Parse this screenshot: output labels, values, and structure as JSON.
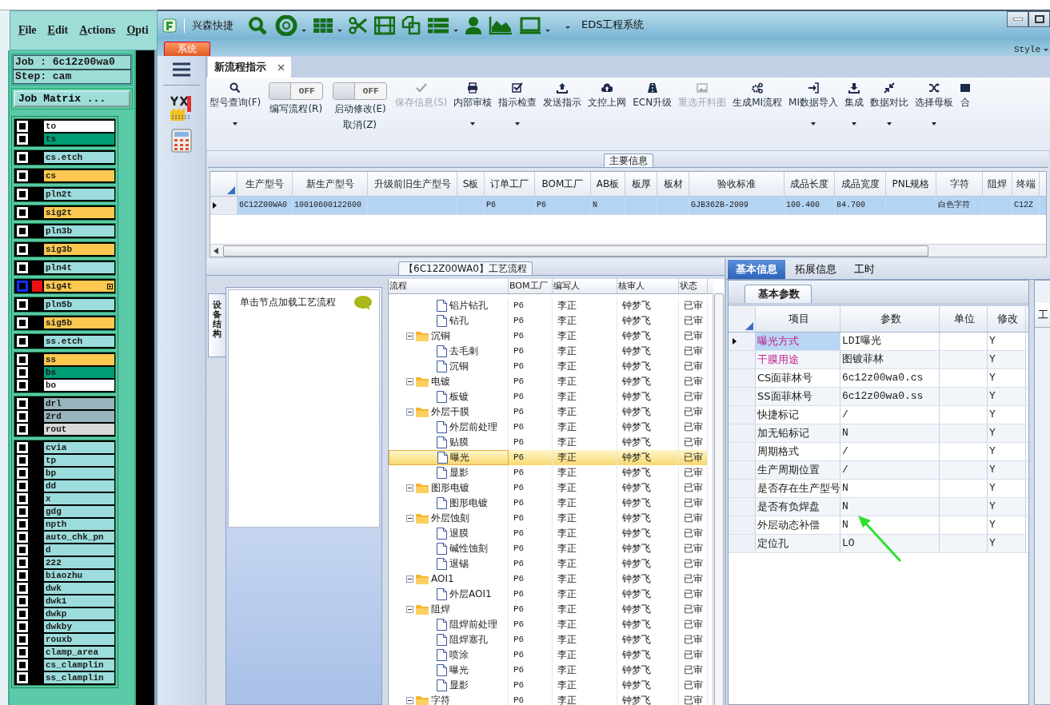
{
  "genesis": {
    "menu": [
      "File",
      "Edit",
      "Actions",
      "Opti"
    ],
    "job": "Job : 6c12z00wa0",
    "step": "Step: cam",
    "matrix_button": "Job Matrix ...",
    "layer_groups": [
      {
        "layers": [
          {
            "name": "to",
            "color": "#ffffff",
            "selected": false
          },
          {
            "name": "ts",
            "color": "#009c74",
            "selected": false
          }
        ]
      },
      {
        "layers": [
          {
            "name": "cs.etch",
            "color": "#9cdcdc",
            "selected": false
          }
        ]
      },
      {
        "layers": [
          {
            "name": "cs",
            "color": "#fcc850",
            "selected": false
          }
        ]
      },
      {
        "layers": [
          {
            "name": "pln2t",
            "color": "#9cdcdc",
            "selected": false
          }
        ]
      },
      {
        "layers": [
          {
            "name": "sig2t",
            "color": "#fcc850",
            "selected": false
          }
        ]
      },
      {
        "layers": [
          {
            "name": "pln3b",
            "color": "#9cdcdc",
            "selected": false
          }
        ]
      },
      {
        "layers": [
          {
            "name": "sig3b",
            "color": "#fcc850",
            "selected": false
          }
        ]
      },
      {
        "layers": [
          {
            "name": "pln4t",
            "color": "#9cdcdc",
            "selected": false
          }
        ]
      },
      {
        "layers": [
          {
            "name": "sig4t",
            "color": "#fcc850",
            "selected": true
          }
        ]
      },
      {
        "layers": [
          {
            "name": "pln5b",
            "color": "#9cdcdc",
            "selected": false
          }
        ]
      },
      {
        "layers": [
          {
            "name": "sig5b",
            "color": "#fcc850",
            "selected": false
          }
        ]
      },
      {
        "layers": [
          {
            "name": "ss.etch",
            "color": "#9cdcdc",
            "selected": false
          }
        ]
      },
      {
        "layers": [
          {
            "name": "ss",
            "color": "#fcc850",
            "selected": false
          },
          {
            "name": "bs",
            "color": "#009c74",
            "selected": false
          },
          {
            "name": "bo",
            "color": "#ffffff",
            "selected": false
          }
        ]
      },
      {
        "layers": [
          {
            "name": "drl",
            "color": "#98b4bc",
            "selected": false
          },
          {
            "name": "2rd",
            "color": "#98b4bc",
            "selected": false
          },
          {
            "name": "rout",
            "color": "#d8d8d8",
            "selected": false
          }
        ]
      },
      {
        "layers": [
          {
            "name": "cvia",
            "color": "#9cdcdc",
            "selected": false
          },
          {
            "name": "tp",
            "color": "#9cdcdc",
            "selected": false
          },
          {
            "name": "bp",
            "color": "#9cdcdc",
            "selected": false
          },
          {
            "name": "dd",
            "color": "#9cdcdc",
            "selected": false
          },
          {
            "name": "x",
            "color": "#9cdcdc",
            "selected": false
          },
          {
            "name": "gdg",
            "color": "#9cdcdc",
            "selected": false
          },
          {
            "name": "npth",
            "color": "#9cdcdc",
            "selected": false
          },
          {
            "name": "auto_chk_pn",
            "color": "#9cdcdc",
            "selected": false
          },
          {
            "name": "d",
            "color": "#9cdcdc",
            "selected": false
          },
          {
            "name": "222",
            "color": "#9cdcdc",
            "selected": false
          },
          {
            "name": "biaozhu",
            "color": "#9cdcdc",
            "selected": false
          },
          {
            "name": "dwk",
            "color": "#9cdcdc",
            "selected": false
          },
          {
            "name": "dwk1",
            "color": "#9cdcdc",
            "selected": false
          },
          {
            "name": "dwkp",
            "color": "#9cdcdc",
            "selected": false
          },
          {
            "name": "dwkby",
            "color": "#9cdcdc",
            "selected": false
          },
          {
            "name": "rouxb",
            "color": "#9cdcdc",
            "selected": false
          },
          {
            "name": "clamp_area",
            "color": "#9cdcdc",
            "selected": false
          },
          {
            "name": "cs_clamplin",
            "color": "#9cdcdc",
            "selected": false
          },
          {
            "name": "ss_clamplin",
            "color": "#9cdcdc",
            "selected": false
          }
        ]
      }
    ]
  },
  "window": {
    "title": "EDS工程系统",
    "quick_access": "兴森快捷",
    "system_tab": "系统",
    "style_menu": "Style"
  },
  "tabs": [
    {
      "label": "新流程指示",
      "selected": true
    }
  ],
  "ribbon": [
    {
      "kind": "button",
      "label": "型号查询(F)",
      "dropdown": true,
      "disabled": false
    },
    {
      "kind": "toggle",
      "label": "编写流程(R)",
      "switch_text": "OFF",
      "on": false
    },
    {
      "kind": "toggle",
      "label": "启动修改(E)",
      "label2": "取消(Z)",
      "switch_text": "OFF",
      "on": false
    },
    {
      "kind": "button",
      "label": "保存信息(S)",
      "dropdown": false,
      "disabled": true
    },
    {
      "kind": "button",
      "label": "内部审核",
      "dropdown": true,
      "disabled": false
    },
    {
      "kind": "button",
      "label": "指示检查",
      "dropdown": true,
      "disabled": false
    },
    {
      "kind": "button",
      "label": "发送指示",
      "dropdown": false,
      "disabled": false
    },
    {
      "kind": "button",
      "label": "文控上网",
      "dropdown": false,
      "disabled": false
    },
    {
      "kind": "button",
      "label": "ECN升级",
      "dropdown": false,
      "disabled": false
    },
    {
      "kind": "button",
      "label": "重选开料图",
      "dropdown": false,
      "disabled": true
    },
    {
      "kind": "button",
      "label": "生成MI流程",
      "dropdown": false,
      "disabled": false
    },
    {
      "kind": "button",
      "label": "MI数据导入",
      "dropdown": true,
      "disabled": false
    },
    {
      "kind": "button",
      "label": "集成",
      "dropdown": true,
      "disabled": false
    },
    {
      "kind": "button",
      "label": "数据对比",
      "dropdown": true,
      "disabled": false
    },
    {
      "kind": "button",
      "label": "选择母板",
      "dropdown": true,
      "disabled": false
    },
    {
      "kind": "button",
      "label": "合",
      "dropdown": false,
      "disabled": false
    }
  ],
  "main_info": {
    "title": "主要信息",
    "columns": [
      {
        "label": "生产型号",
        "value": "6C12Z00WA0"
      },
      {
        "label": "新生产型号",
        "value": "10010600122600"
      },
      {
        "label": "升级前旧生产型号"
      },
      {
        "label": "S板"
      },
      {
        "label": "订单工厂",
        "value": "P6"
      },
      {
        "label": "BOM工厂",
        "value": "P6"
      },
      {
        "label": "AB板",
        "value": "N"
      },
      {
        "label": "板厚"
      },
      {
        "label": "板材"
      },
      {
        "label": "验收标准",
        "value": "GJB362B-2009"
      },
      {
        "label": "成品长度",
        "value": "100.400"
      },
      {
        "label": "成品宽度",
        "value": "84.700"
      },
      {
        "label": "PNL规格"
      },
      {
        "label": "字符",
        "value": "白色字符"
      },
      {
        "label": "阻焊"
      },
      {
        "label": "终端",
        "value": "C12Z"
      }
    ],
    "row_selected": true
  },
  "process": {
    "title": "【6C12Z00WA0】工艺流程",
    "side_tab": "设备结构",
    "hint": "单击节点加载工艺流程",
    "columns": [
      "流程",
      "BOM工厂",
      "编写人",
      "核审人",
      "状态"
    ],
    "nodes": [
      {
        "children": [
          {
            "label": "铝片钻孔",
            "bom": "P6",
            "author": "李正",
            "reviewer": "钟梦飞",
            "status": "已审",
            "selected": false
          },
          {
            "label": "钻孔",
            "bom": "P6",
            "author": "李正",
            "reviewer": "钟梦飞",
            "status": "已审",
            "selected": false
          }
        ]
      },
      {
        "label": "沉铜",
        "bom": "P6",
        "author": "李正",
        "reviewer": "钟梦飞",
        "status": "已审",
        "selected": false,
        "expanded": true,
        "children": [
          {
            "label": "去毛刺",
            "bom": "P6",
            "author": "李正",
            "reviewer": "钟梦飞",
            "status": "已审",
            "selected": false
          },
          {
            "label": "沉铜",
            "bom": "P6",
            "author": "李正",
            "reviewer": "钟梦飞",
            "status": "已审",
            "selected": false
          }
        ]
      },
      {
        "label": "电镀",
        "bom": "P6",
        "author": "李正",
        "reviewer": "钟梦飞",
        "status": "已审",
        "selected": false,
        "expanded": true,
        "children": [
          {
            "label": "板镀",
            "bom": "P6",
            "author": "李正",
            "reviewer": "钟梦飞",
            "status": "已审",
            "selected": false
          }
        ]
      },
      {
        "label": "外层干膜",
        "bom": "P6",
        "author": "李正",
        "reviewer": "钟梦飞",
        "status": "已审",
        "selected": false,
        "expanded": true,
        "children": [
          {
            "label": "外层前处理",
            "bom": "P6",
            "author": "李正",
            "reviewer": "钟梦飞",
            "status": "已审",
            "selected": false
          },
          {
            "label": "贴膜",
            "bom": "P6",
            "author": "李正",
            "reviewer": "钟梦飞",
            "status": "已审",
            "selected": false
          },
          {
            "label": "曝光",
            "bom": "P6",
            "author": "李正",
            "reviewer": "钟梦飞",
            "status": "已审",
            "selected": true
          },
          {
            "label": "显影",
            "bom": "P6",
            "author": "李正",
            "reviewer": "钟梦飞",
            "status": "已审",
            "selected": false
          }
        ]
      },
      {
        "label": "图形电镀",
        "bom": "P6",
        "author": "李正",
        "reviewer": "钟梦飞",
        "status": "已审",
        "selected": false,
        "expanded": true,
        "children": [
          {
            "label": "图形电镀",
            "bom": "P6",
            "author": "李正",
            "reviewer": "钟梦飞",
            "status": "已审",
            "selected": false
          }
        ]
      },
      {
        "label": "外层蚀刻",
        "bom": "P6",
        "author": "李正",
        "reviewer": "钟梦飞",
        "status": "已审",
        "selected": false,
        "expanded": true,
        "children": [
          {
            "label": "退膜",
            "bom": "P6",
            "author": "李正",
            "reviewer": "钟梦飞",
            "status": "已审",
            "selected": false
          },
          {
            "label": "碱性蚀刻",
            "bom": "P6",
            "author": "李正",
            "reviewer": "钟梦飞",
            "status": "已审",
            "selected": false
          },
          {
            "label": "退锡",
            "bom": "P6",
            "author": "李正",
            "reviewer": "钟梦飞",
            "status": "已审",
            "selected": false
          }
        ]
      },
      {
        "label": "AOI1",
        "bom": "P6",
        "author": "李正",
        "reviewer": "钟梦飞",
        "status": "已审",
        "selected": false,
        "expanded": true,
        "children": [
          {
            "label": "外层AOI1",
            "bom": "P6",
            "author": "李正",
            "reviewer": "钟梦飞",
            "status": "已审",
            "selected": false
          }
        ]
      },
      {
        "label": "阻焊",
        "bom": "P6",
        "author": "李正",
        "reviewer": "钟梦飞",
        "status": "已审",
        "selected": false,
        "expanded": true,
        "children": [
          {
            "label": "阻焊前处理",
            "bom": "P6",
            "author": "李正",
            "reviewer": "钟梦飞",
            "status": "已审",
            "selected": false
          },
          {
            "label": "阻焊塞孔",
            "bom": "P6",
            "author": "李正",
            "reviewer": "钟梦飞",
            "status": "已审",
            "selected": false
          },
          {
            "label": "喷涂",
            "bom": "P6",
            "author": "李正",
            "reviewer": "钟梦飞",
            "status": "已审",
            "selected": false
          },
          {
            "label": "曝光",
            "bom": "P6",
            "author": "李正",
            "reviewer": "钟梦飞",
            "status": "已审",
            "selected": false
          },
          {
            "label": "显影",
            "bom": "P6",
            "author": "李正",
            "reviewer": "钟梦飞",
            "status": "已审",
            "selected": false
          }
        ]
      },
      {
        "label": "字符",
        "bom": "P6",
        "author": "李正",
        "reviewer": "钟梦飞",
        "status": "已审",
        "selected": false,
        "expanded": true
      }
    ]
  },
  "details": {
    "tabs": [
      {
        "label": "基本信息",
        "selected": true
      },
      {
        "label": "拓展信息",
        "selected": false
      },
      {
        "label": "工时",
        "selected": false
      }
    ],
    "sub_tab": "基本参数",
    "columns": [
      "项目",
      "参数",
      "单位",
      "修改"
    ],
    "rows": [
      {
        "item": "曝光方式",
        "param": "LDI曝光",
        "modify": "Y",
        "color": "#c0208a",
        "selected": true
      },
      {
        "item": "干膜用途",
        "param": "图镀菲林",
        "modify": "Y",
        "color": "#c0208a",
        "selected": false
      },
      {
        "item": "CS面菲林号",
        "param": "6c12z00wa0.cs",
        "modify": "Y",
        "selected": false
      },
      {
        "item": "SS面菲林号",
        "param": "6c12z00wa0.ss",
        "modify": "Y",
        "selected": false
      },
      {
        "item": "快捷标记",
        "param": "/",
        "modify": "Y",
        "selected": false
      },
      {
        "item": "加无铅标记",
        "param": "N",
        "modify": "Y",
        "selected": false
      },
      {
        "item": "周期格式",
        "param": "/",
        "modify": "Y",
        "selected": false
      },
      {
        "item": "生产周期位置",
        "param": "/",
        "modify": "Y",
        "selected": false
      },
      {
        "item": "是否存在生产型号",
        "param": "N",
        "modify": "Y",
        "selected": false
      },
      {
        "item": "是否有负焊盘",
        "param": "N",
        "modify": "Y",
        "selected": false
      },
      {
        "item": "外层动态补偿",
        "param": "N",
        "modify": "Y",
        "selected": false
      },
      {
        "item": "定位孔",
        "param": "LO",
        "modify": "Y",
        "selected": false
      }
    ],
    "side_panel_header": "工"
  }
}
